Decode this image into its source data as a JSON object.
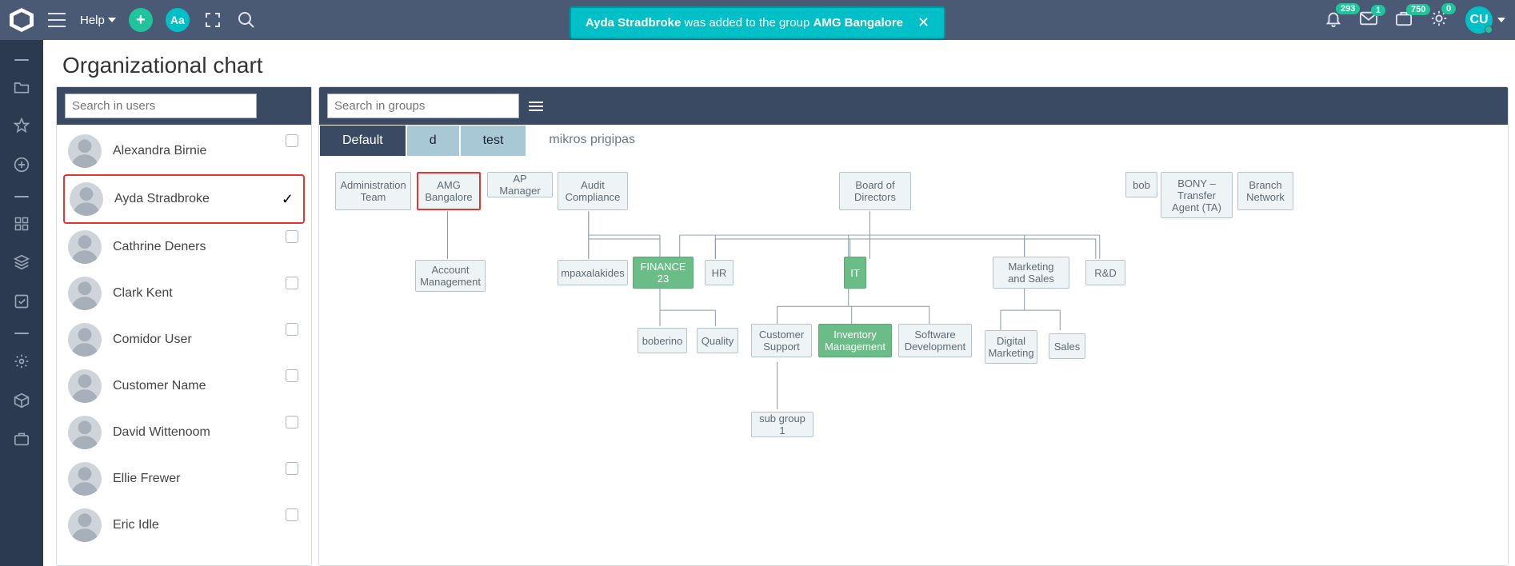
{
  "header": {
    "help": "Help",
    "aa": "Aa",
    "plus": "+",
    "badges": {
      "bell": "293",
      "mail": "1",
      "briefcase": "750",
      "sun": "0"
    },
    "avatar": "CU"
  },
  "toast": {
    "user": "Ayda Stradbroke",
    "mid": " was added to the group ",
    "group": "AMG Bangalore"
  },
  "title": "Organizational chart",
  "search_users_ph": "Search in users",
  "search_groups_ph": "Search in groups",
  "users": [
    {
      "name": "Alexandra Birnie",
      "selected": false
    },
    {
      "name": "Ayda Stradbroke",
      "selected": true
    },
    {
      "name": "Cathrine Deners",
      "selected": false
    },
    {
      "name": "Clark Kent",
      "selected": false
    },
    {
      "name": "Comidor User",
      "selected": false
    },
    {
      "name": "Customer Name",
      "selected": false
    },
    {
      "name": "David Wittenoom",
      "selected": false
    },
    {
      "name": "Ellie Frewer",
      "selected": false
    },
    {
      "name": "Eric Idle",
      "selected": false
    }
  ],
  "tabs": [
    {
      "label": "Default",
      "active": true
    },
    {
      "label": "d",
      "active": false
    },
    {
      "label": "test",
      "active": false
    },
    {
      "label": "mikros prigipas",
      "plain": true
    }
  ],
  "nodes": {
    "admin": {
      "label": "Administration Team"
    },
    "amg": {
      "label": "AMG Bangalore"
    },
    "ap": {
      "label": "AP Manager"
    },
    "audit": {
      "label": "Audit Compliance"
    },
    "board": {
      "label": "Board of Directors"
    },
    "bob": {
      "label": "bob"
    },
    "bony": {
      "label": "BONY – Transfer Agent (TA)"
    },
    "branch": {
      "label": "Branch Network"
    },
    "account": {
      "label": "Account Management"
    },
    "mpax": {
      "label": "mpaxalakides"
    },
    "fin": {
      "label": "FINANCE 23"
    },
    "hr": {
      "label": "HR"
    },
    "it": {
      "label": "IT"
    },
    "mkt": {
      "label": "Marketing and Sales"
    },
    "rd": {
      "label": "R&D"
    },
    "bobe": {
      "label": "boberino"
    },
    "qual": {
      "label": "Quality"
    },
    "cs": {
      "label": "Customer Support"
    },
    "inv": {
      "label": "Inventory Management"
    },
    "sw": {
      "label": "Software Development"
    },
    "dm": {
      "label": "Digital Marketing"
    },
    "sales": {
      "label": "Sales"
    },
    "sub": {
      "label": "sub group 1"
    }
  }
}
